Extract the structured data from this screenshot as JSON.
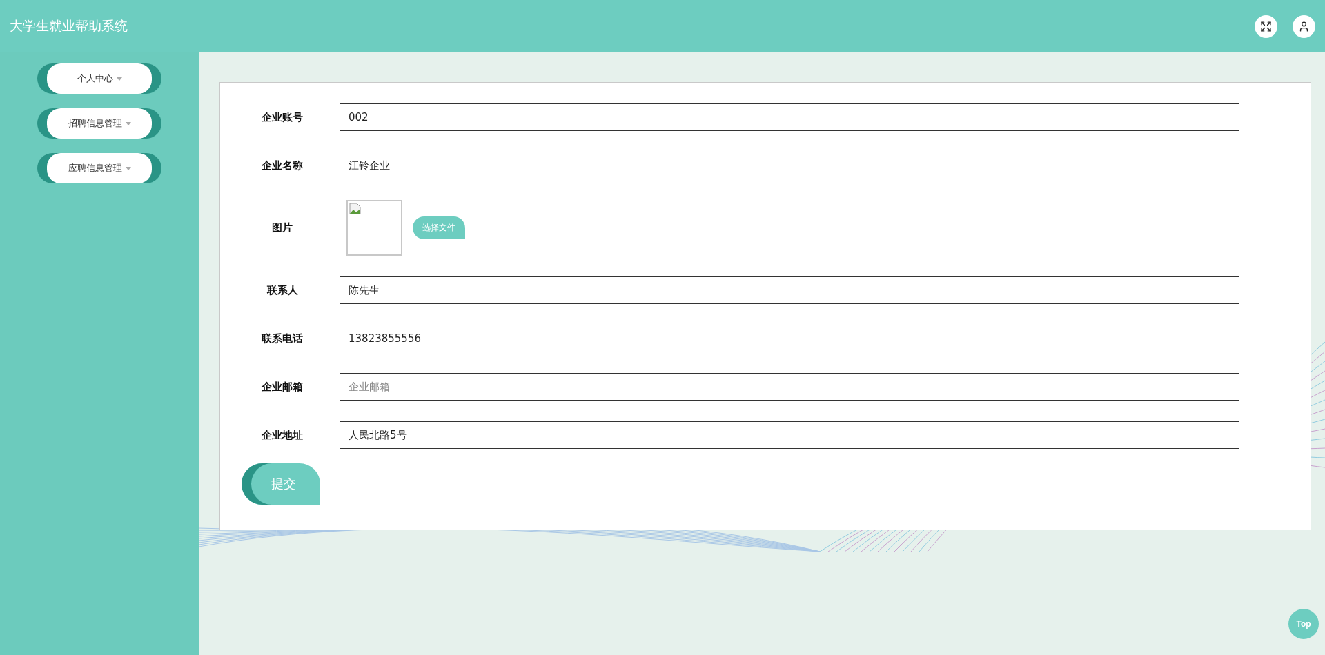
{
  "header": {
    "title": "大学生就业帮助系统"
  },
  "sidebar": {
    "items": [
      {
        "label": "个人中心"
      },
      {
        "label": "招聘信息管理"
      },
      {
        "label": "应聘信息管理"
      }
    ]
  },
  "form": {
    "fields": [
      {
        "kind": "text",
        "label": "企业账号",
        "value": "002"
      },
      {
        "kind": "text",
        "label": "企业名称",
        "value": "江铃企业"
      },
      {
        "kind": "image",
        "label": "图片",
        "button": "选择文件"
      },
      {
        "kind": "text",
        "label": "联系人",
        "value": "陈先生"
      },
      {
        "kind": "text",
        "label": "联系电话",
        "value": "13823855556"
      },
      {
        "kind": "text",
        "label": "企业邮箱",
        "placeholder": "企业邮箱"
      },
      {
        "kind": "text",
        "label": "企业地址",
        "value": "人民北路5号"
      }
    ],
    "submit": "提交"
  },
  "back_to_top": "Top"
}
